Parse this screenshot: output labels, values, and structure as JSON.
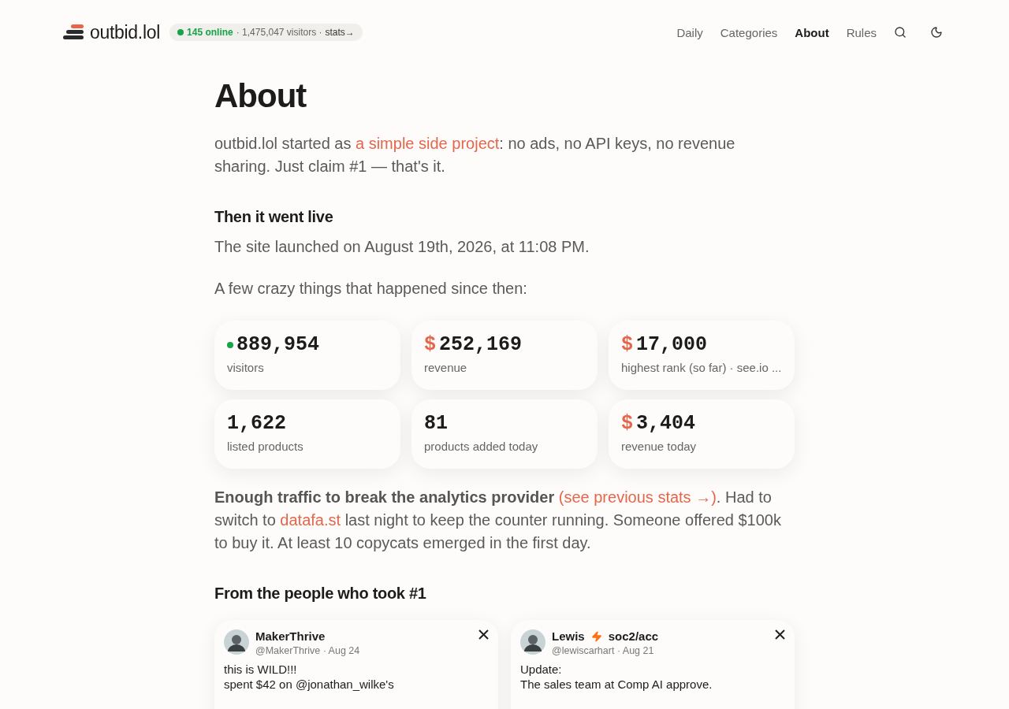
{
  "header": {
    "logo": "outbid.lol",
    "status": {
      "online": "145 online",
      "visitors": "· 1,475,047 visitors ·",
      "stats_link": "stats→"
    },
    "nav": [
      {
        "label": "Daily",
        "selected": false
      },
      {
        "label": "Categories",
        "selected": false
      },
      {
        "label": "About",
        "selected": true
      },
      {
        "label": "Rules",
        "selected": false
      }
    ]
  },
  "title": "About",
  "intro": [
    {
      "kind": "plain",
      "text": "outbid.lol started as "
    },
    {
      "kind": "link",
      "text": "a simple side project"
    },
    {
      "kind": "plain",
      "text": ": no ads, no API keys, no revenue sharing. Just claim #1 — that's it."
    }
  ],
  "section_live": {
    "heading": "Then it went live",
    "launch": "The site launched on August 19th, 2026, at 11:08 PM.",
    "lead": "A few crazy things that happened since then:"
  },
  "stats": [
    {
      "kind": "dot",
      "color": "#16a34a",
      "value": "889,954",
      "label": "visitors"
    },
    {
      "kind": "dollar",
      "prefix": "$",
      "value": "252,169",
      "label": "revenue"
    },
    {
      "kind": "dollar",
      "prefix": "$",
      "value": "17,000",
      "label": "highest rank (so far) · see.io ..."
    },
    {
      "kind": "plain",
      "value": "1,622",
      "label": "listed products"
    },
    {
      "kind": "plain",
      "value": "81",
      "label": "products added today"
    },
    {
      "kind": "dollar",
      "prefix": "$",
      "value": "3,404",
      "label": "revenue today"
    }
  ],
  "traffic": [
    {
      "kind": "bold",
      "text": "Enough traffic to break the analytics provider "
    },
    {
      "kind": "link",
      "text": "(see previous stats →)"
    },
    {
      "kind": "plain",
      "text": ". Had to switch to "
    },
    {
      "kind": "link",
      "text": "datafa.st"
    },
    {
      "kind": "plain",
      "text": " last night to keep the counter running. Someone offered $100k to buy it. At least 10 copycats emerged in the first day."
    }
  ],
  "testimonials_heading": "From the people who took #1",
  "tweets": [
    {
      "name": "MakerThrive",
      "handle": "@MakerThrive",
      "date": "· Aug 24",
      "lines": [
        "this is WILD!!!",
        "spent $42 on @jonathan_wilke's"
      ]
    },
    {
      "name": "Lewis",
      "name_suffix": "soc2/acc",
      "handle": "@lewiscarhart",
      "date": "· Aug 21",
      "lines": [
        "Update:",
        "The sales team at Comp AI approve."
      ]
    }
  ]
}
